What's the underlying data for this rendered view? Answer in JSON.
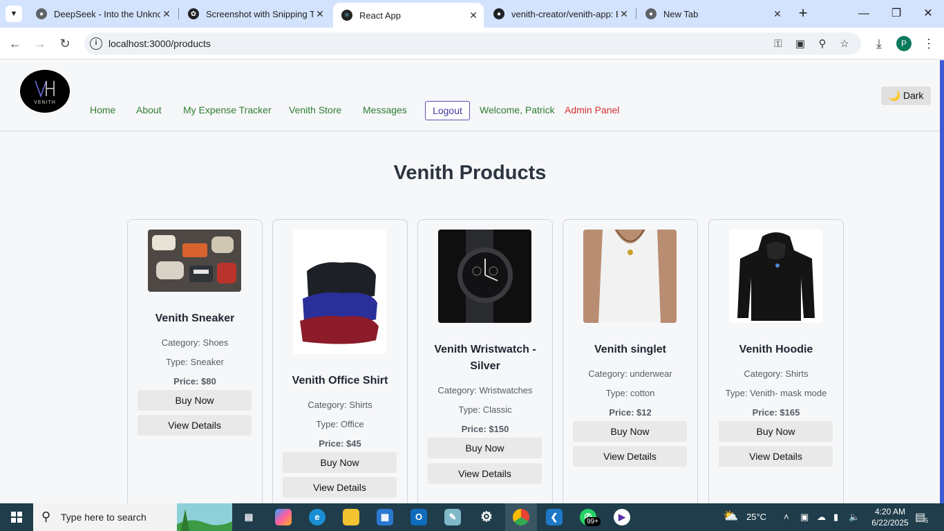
{
  "browser": {
    "tabs": [
      {
        "title": "DeepSeek - Into the Unknown",
        "active": false
      },
      {
        "title": "Screenshot with Snipping Tool",
        "active": false
      },
      {
        "title": "React App",
        "active": true
      },
      {
        "title": "venith-creator/venith-app: Ex",
        "active": false
      },
      {
        "title": "New Tab",
        "active": false
      }
    ],
    "url": "localhost:3000/products",
    "profile_initial": "P"
  },
  "navbar": {
    "logo_text": "VENITH",
    "links": [
      "Home",
      "About",
      "My Expense Tracker",
      "Venith Store",
      "Messages"
    ],
    "logout_label": "Logout",
    "welcome": "Welcome, Patrick",
    "admin_label": "Admin Panel",
    "theme_toggle": "🌙 Dark"
  },
  "page": {
    "title": "Venith Products"
  },
  "products": [
    {
      "name": "Venith Sneaker",
      "category": "Category: Shoes",
      "type": "Type: Sneaker",
      "price": "Price: $80",
      "buy": "Buy Now",
      "details": "View Details"
    },
    {
      "name": "Venith Office Shirt",
      "category": "Category: Shirts",
      "type": "Type: Office",
      "price": "Price: $45",
      "buy": "Buy Now",
      "details": "View Details"
    },
    {
      "name": "Venith Wristwatch - Silver",
      "category": "Category: Wristwatches",
      "type": "Type: Classic",
      "price": "Price: $150",
      "buy": "Buy Now",
      "details": "View Details"
    },
    {
      "name": "Venith singlet",
      "category": "Category: underwear",
      "type": "Type: cotton",
      "price": "Price: $12",
      "buy": "Buy Now",
      "details": "View Details"
    },
    {
      "name": "Venith Hoodie",
      "category": "Category: Shirts",
      "type": "Type: Venith- mask mode",
      "price": "Price: $165",
      "buy": "Buy Now",
      "details": "View Details"
    }
  ],
  "taskbar": {
    "search_placeholder": "Type here to search",
    "whatsapp_badge": "99+",
    "weather": "25°C",
    "time": "4:20 AM",
    "date": "6/22/2025",
    "notifications": "5"
  },
  "colors": {
    "nav_link": "#2e7d32",
    "admin_link": "#d32f2f",
    "logout_border": "#5d4db6",
    "title": "#2b3440",
    "taskbar": "#1f3d4a"
  }
}
